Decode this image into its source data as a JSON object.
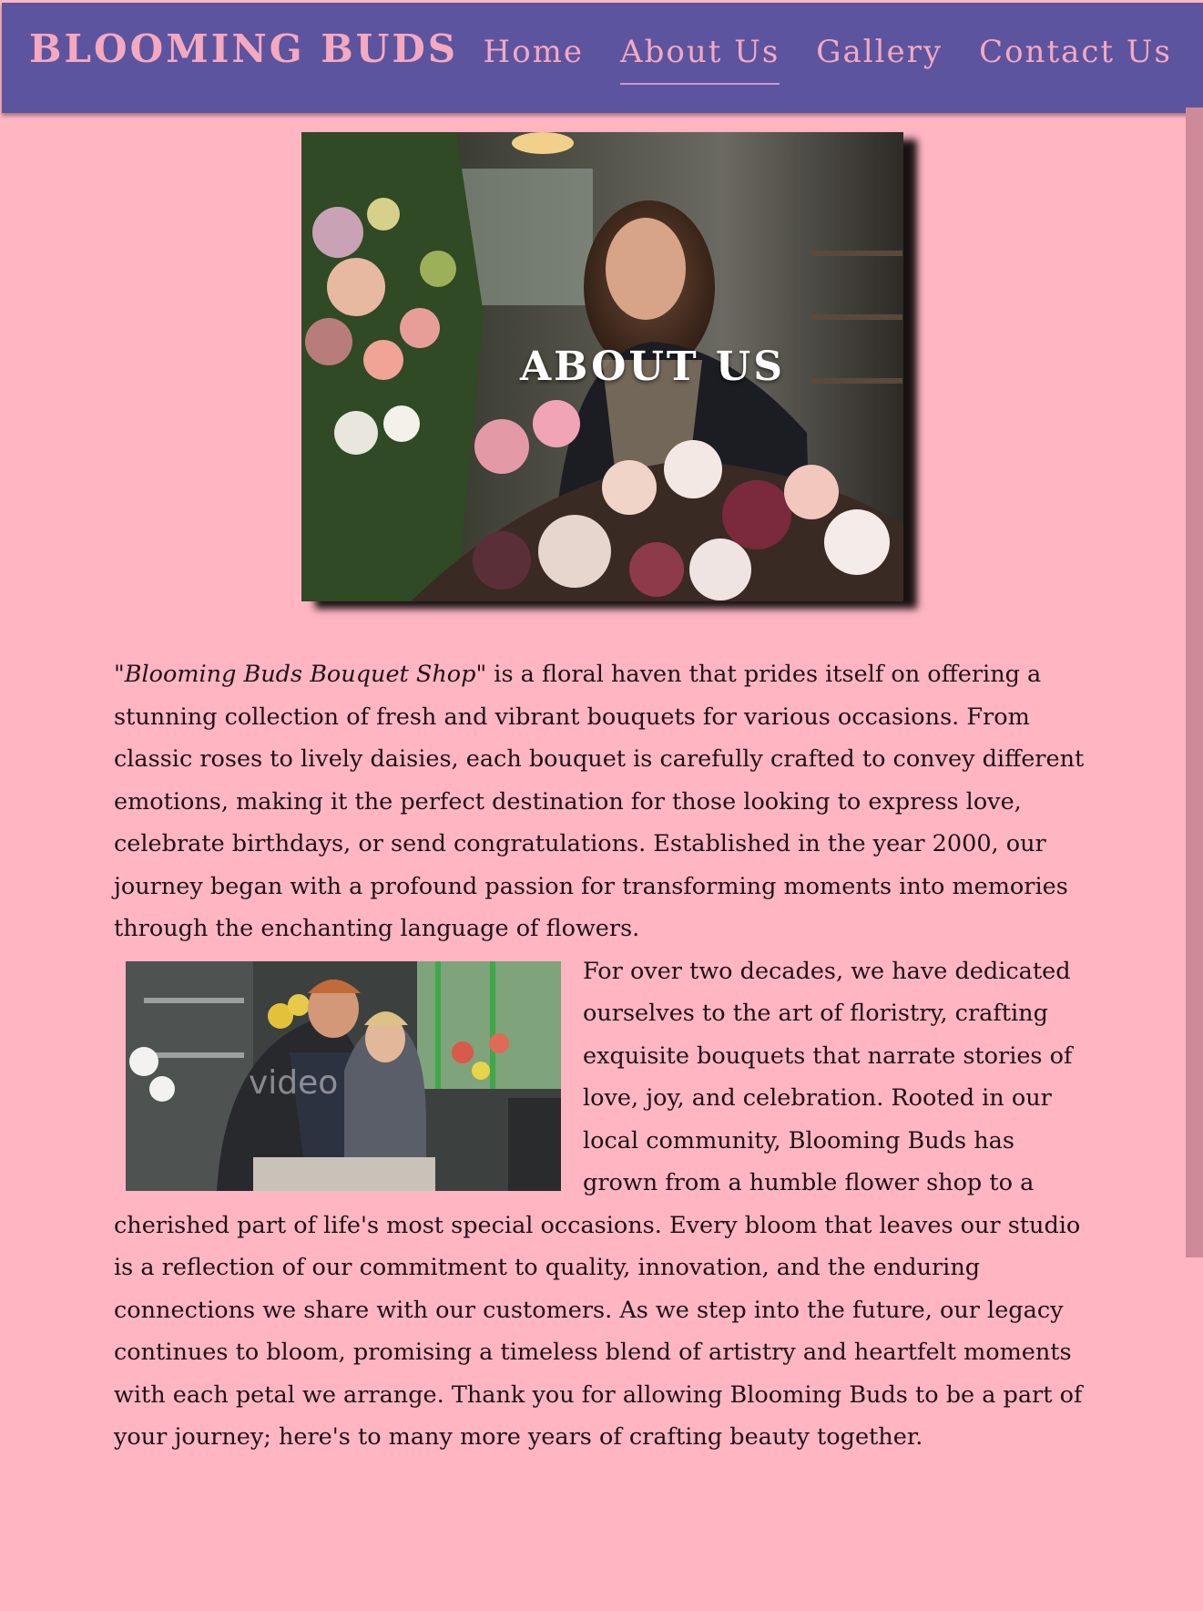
{
  "navbar": {
    "brand": "BLOOMING BUDS",
    "links": [
      {
        "label": "Home",
        "active": false
      },
      {
        "label": "About Us",
        "active": true
      },
      {
        "label": "Gallery",
        "active": false
      },
      {
        "label": "Contact Us",
        "active": false
      }
    ]
  },
  "hero": {
    "title": "ABOUT US",
    "image": "florist-arranging-flowers-photo"
  },
  "about": {
    "shop_name": "\"Blooming Buds Bouquet Shop\"",
    "paragraph1": " is a floral haven that prides itself on offering a stunning collection of fresh and vibrant bouquets for various occasions. From classic roses to lively daisies, each bouquet is carefully crafted to convey different emotions, making it the perfect destination for those looking to express love, celebrate birthdays, or send congratulations. Established in the year 2000, our journey began with a profound passion for transforming moments into memories through the enchanting language of flowers.",
    "paragraph2": "For over two decades, we have dedicated ourselves to the art of floristry, crafting exquisite bouquets that narrate stories of love, joy, and celebration. Rooted in our local community, Blooming Buds has grown from a humble flower shop to a cherished part of life's most special occasions. Every bloom that leaves our studio is a reflection of our commitment to quality, innovation, and the enduring connections we share with our customers. As we step into the future, our legacy continues to bloom, promising a timeless blend of artistry and heartfelt moments with each petal we arrange. Thank you for allowing Blooming Buds to be a part of your journey; here's to many more years of crafting beauty together.",
    "inline_image": "florists-working-video-still",
    "inline_image_watermark": "video"
  },
  "colors": {
    "navbar_bg": "#5d54a0",
    "brand_pink": "#f4a9bf",
    "page_bg": "#ffb5c2",
    "text": "#1b1416"
  }
}
